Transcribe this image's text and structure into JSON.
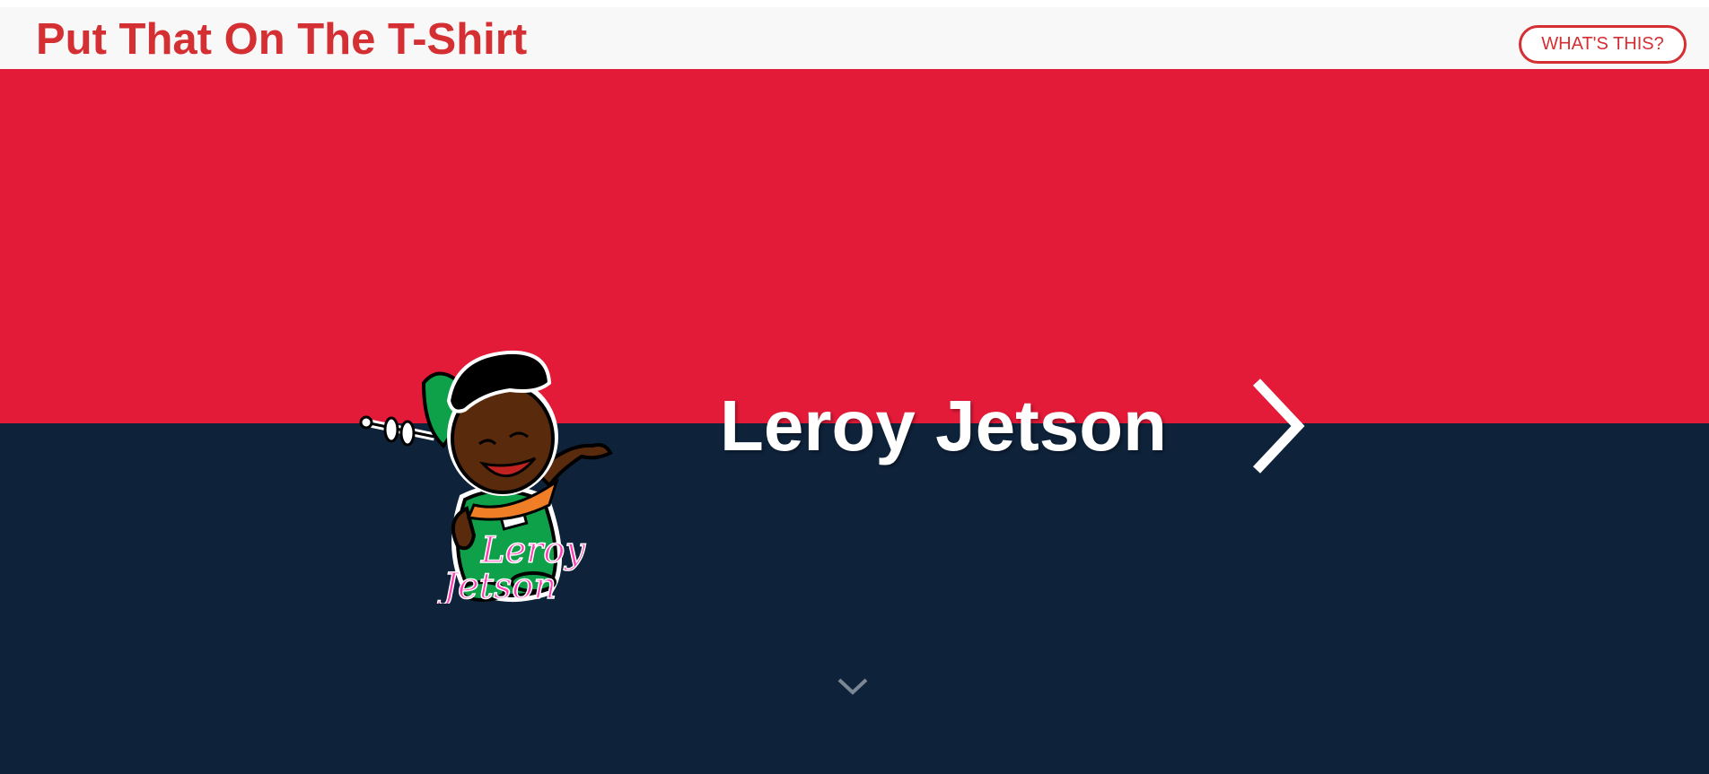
{
  "header": {
    "site_title": "Put That On The T-Shirt",
    "whats_this_label": "WHAT'S THIS?"
  },
  "hero": {
    "design_name": "Leroy Jetson",
    "artwork_text_line1": "Leroy",
    "artwork_text_line2": "Jetson",
    "colors": {
      "top_band": "#e31a38",
      "bottom_band": "#0e223a",
      "accent": "#d42f33"
    }
  },
  "icons": {
    "next": "chevron-right-icon",
    "scroll": "chevron-down-icon"
  }
}
